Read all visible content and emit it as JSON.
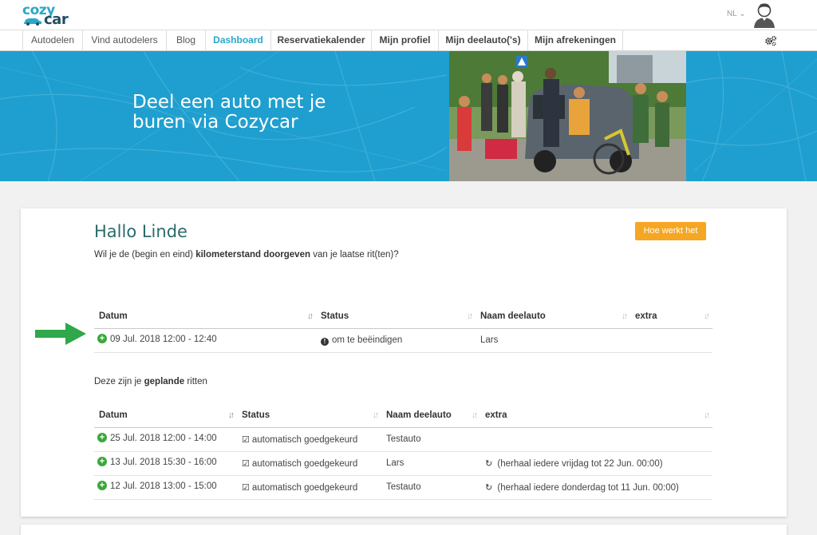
{
  "brand": {
    "logo_top": "cozy",
    "logo_bottom": "car"
  },
  "header": {
    "language": "NL ⌄"
  },
  "nav": {
    "items": [
      {
        "label": "Autodelen"
      },
      {
        "label": "Vind autodelers"
      },
      {
        "label": "Blog"
      },
      {
        "label": "Dashboard"
      },
      {
        "label": "Reservatiekalender"
      },
      {
        "label": "Mijn profiel"
      },
      {
        "label": "Mijn deelauto('s)"
      },
      {
        "label": "Mijn afrekeningen"
      }
    ]
  },
  "hero": {
    "line1": "Deel een auto met je",
    "line2": "buren via Cozycar"
  },
  "dashboard": {
    "greeting": "Hallo Linde",
    "help_button": "Hoe werkt het",
    "intro_pre": "Wil je de (begin en eind) ",
    "intro_bold": "kilometerstand doorgeven",
    "intro_post": " van je laatse rit(ten)?",
    "planned_pre": "Deze zijn je ",
    "planned_bold": "geplande",
    "planned_post": " ritten"
  },
  "columns": {
    "date": "Datum",
    "status": "Status",
    "car": "Naam deelauto",
    "extra": "extra"
  },
  "pending_rides": [
    {
      "date": "09 Jul. 2018 12:00 - 12:40",
      "status": "om te beëindigen",
      "car": "Lars",
      "extra": ""
    }
  ],
  "planned_rides": [
    {
      "date": "25 Jul. 2018 12:00 - 14:00",
      "status": "automatisch goedgekeurd",
      "car": "Testauto",
      "extra": ""
    },
    {
      "date": "13 Jul. 2018 15:30 - 16:00",
      "status": "automatisch goedgekeurd",
      "car": "Lars",
      "extra": "(herhaal iedere vrijdag tot 22 Jun. 00:00)"
    },
    {
      "date": "12 Jul. 2018 13:00 - 15:00",
      "status": "automatisch goedgekeurd",
      "car": "Testauto",
      "extra": "(herhaal iedere donderdag tot 11 Jun. 00:00)"
    }
  ],
  "icons": {
    "sort": "sort-icon",
    "add": "plus-circle-icon",
    "info": "info-circle-icon",
    "approved": "check-square-icon",
    "repeat": "repeat-icon",
    "settings": "gears-icon",
    "arrow": "green-arrow-icon"
  },
  "colors": {
    "brand": "#2aa8c8",
    "hero": "#1f9fcf",
    "button": "#f5a623",
    "add": "#3aa83a",
    "arrow": "#2ea84a"
  }
}
